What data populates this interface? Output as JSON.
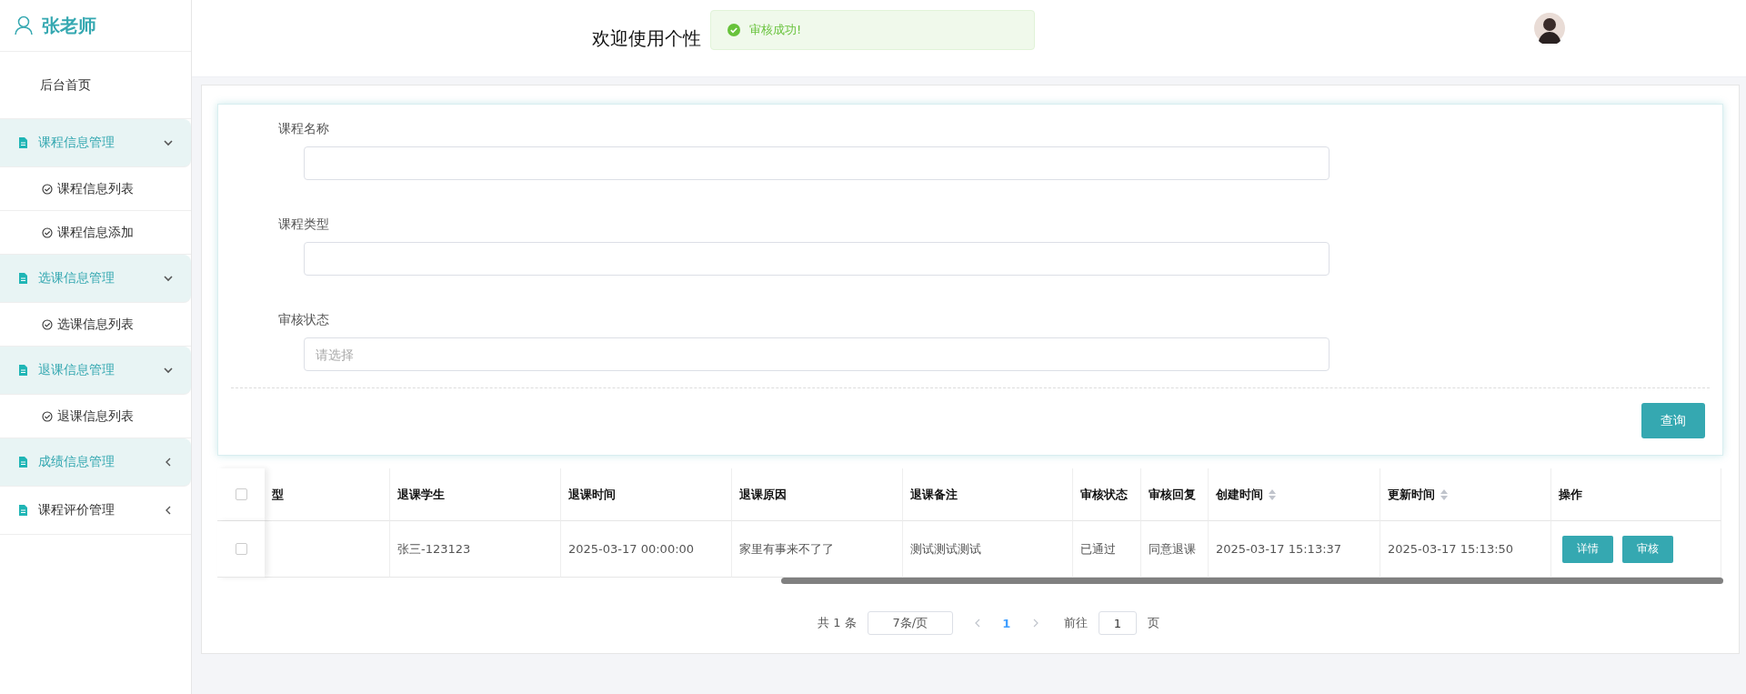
{
  "sidebar": {
    "user": "张老师",
    "home": "后台首页",
    "groups": [
      {
        "label": "课程信息管理",
        "expanded": true,
        "highlighted": true,
        "children": [
          {
            "label": "课程信息列表"
          },
          {
            "label": "课程信息添加"
          }
        ]
      },
      {
        "label": "选课信息管理",
        "expanded": true,
        "highlighted": true,
        "children": [
          {
            "label": "选课信息列表"
          }
        ]
      },
      {
        "label": "退课信息管理",
        "expanded": true,
        "highlighted": true,
        "children": [
          {
            "label": "退课信息列表"
          }
        ]
      },
      {
        "label": "成绩信息管理",
        "expanded": false,
        "highlighted": true
      },
      {
        "label": "课程评价管理",
        "expanded": false,
        "highlighted": false
      }
    ]
  },
  "header": {
    "title": "欢迎使用个性",
    "toast": "审核成功!"
  },
  "search_form": {
    "fields": [
      {
        "label": "课程名称"
      },
      {
        "label": "课程类型"
      },
      {
        "label": "审核状态",
        "placeholder": "请选择"
      }
    ],
    "button": "查询"
  },
  "table": {
    "header_checked": false,
    "columns": [
      {
        "label": "型"
      },
      {
        "label": "退课学生"
      },
      {
        "label": "退课时间"
      },
      {
        "label": "退课原因"
      },
      {
        "label": "退课备注"
      },
      {
        "label": "审核状态"
      },
      {
        "label": "审核回复"
      },
      {
        "label": "创建时间",
        "sortable": true
      },
      {
        "label": "更新时间",
        "sortable": true
      },
      {
        "label": "操作"
      }
    ],
    "rows": [
      {
        "checked": false,
        "cells": [
          "",
          "张三-123123",
          "2025-03-17 00:00:00",
          "家里有事来不了了",
          "测试测试测试",
          "已通过",
          "同意退课",
          "2025-03-17 15:13:37",
          "2025-03-17 15:13:50"
        ],
        "actions": [
          "详情",
          "审核"
        ]
      }
    ]
  },
  "pagination": {
    "total": "共 1 条",
    "page_size": "7条/页",
    "pages": [
      {
        "label": "1",
        "selected": true
      }
    ],
    "goto_label": "前往",
    "goto_value": "1",
    "goto_suffix": "页"
  }
}
